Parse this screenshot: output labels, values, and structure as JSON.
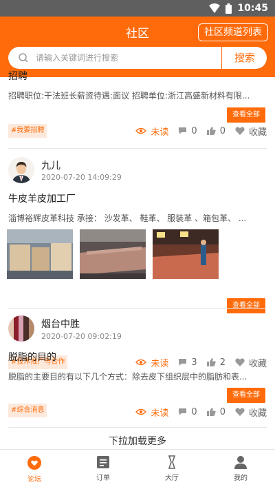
{
  "status_bar": {
    "time": "10:45"
  },
  "header": {
    "title": "社区",
    "channel_button": "社区频道列表"
  },
  "search": {
    "placeholder": "请输入关键词进行搜索",
    "button": "搜索"
  },
  "posts": [
    {
      "title": "招聘",
      "body": "招聘职位:干法班长薪资待遇:面议 招聘单位:浙江高盛新材料有限...",
      "view_all": "查看全部",
      "tag": "#我要招聘",
      "unread": "未读",
      "comments": "0",
      "likes": "0",
      "favorite": "收藏"
    },
    {
      "author": "九儿",
      "time": "2020-07-20 14:09:29",
      "title": "牛皮羊皮加工厂",
      "body": "淄博裕辉皮革科技 承接：  沙发革、 鞋革、 服装革 、箱包革、  ...",
      "view_all": "查看全部",
      "tag": "#技术推广与合作",
      "unread": "未读",
      "comments": "3",
      "likes": "2",
      "favorite": "收藏"
    },
    {
      "author": "烟台中胜",
      "time": "2020-07-20 09:02:19",
      "title": "脱脂的目的",
      "body": "脱脂的主要目的有以下几个方式：除去皮下组织层中的脂肪和表...",
      "view_all": "查看全部",
      "tag": "#综合消息",
      "unread": "未读",
      "comments": "0",
      "likes": "0",
      "favorite": "收藏"
    }
  ],
  "load_more": "下拉加载更多",
  "tabs": [
    {
      "label": "论坛",
      "icon": "forum-icon",
      "active": true
    },
    {
      "label": "订单",
      "icon": "order-icon",
      "active": false
    },
    {
      "label": "大厅",
      "icon": "hall-icon",
      "active": false
    },
    {
      "label": "我的",
      "icon": "profile-icon",
      "active": false
    }
  ],
  "colors": {
    "accent": "#ff6b0a",
    "tag_bg": "#fde9dc",
    "status_bar": "#5f5f5f"
  }
}
